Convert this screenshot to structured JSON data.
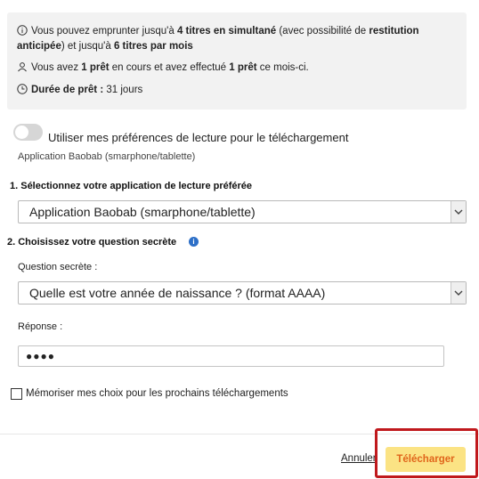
{
  "info": {
    "line1_pre": "Vous pouvez emprunter jusqu'à ",
    "line1_bold1": "4 titres en simultané",
    "line1_mid": " (avec possibilité de ",
    "line1_bold2": "restitution",
    "line2_bold": "anticipée",
    "line2_mid": ") et jusqu'à ",
    "line2_bold2": "6 titres par mois",
    "line3_pre": "Vous avez ",
    "line3_bold1": "1 prêt",
    "line3_mid": " en cours et avez effectué ",
    "line3_bold2": "1 prêt",
    "line3_post": " ce mois-ci.",
    "line4_bold": "Durée de prêt :",
    "line4_val": " 31 jours"
  },
  "preferences": {
    "toggle_label": "Utiliser mes préférences de lecture pour le téléchargement",
    "app_sub": "Application Baobab (smarphone/tablette)"
  },
  "step1": {
    "title": "1. Sélectionnez votre application de lecture préférée",
    "selected": "Application Baobab (smarphone/tablette)"
  },
  "step2": {
    "title": "2. Choisissez votre question secrète",
    "info_glyph": "i",
    "question_label": "Question secrète :",
    "question_selected": "Quelle est votre année de naissance ? (format AAAA)",
    "answer_label": "Réponse :",
    "answer_value": "●●●●"
  },
  "remember": {
    "label": "Mémoriser mes choix pour les prochains téléchargements"
  },
  "actions": {
    "cancel": "Annuler",
    "download": "Télécharger"
  },
  "colors": {
    "download_bg": "#fbe384",
    "download_text": "#e0651b",
    "highlight": "#c0191d",
    "info_icon": "#2d6fc7"
  }
}
